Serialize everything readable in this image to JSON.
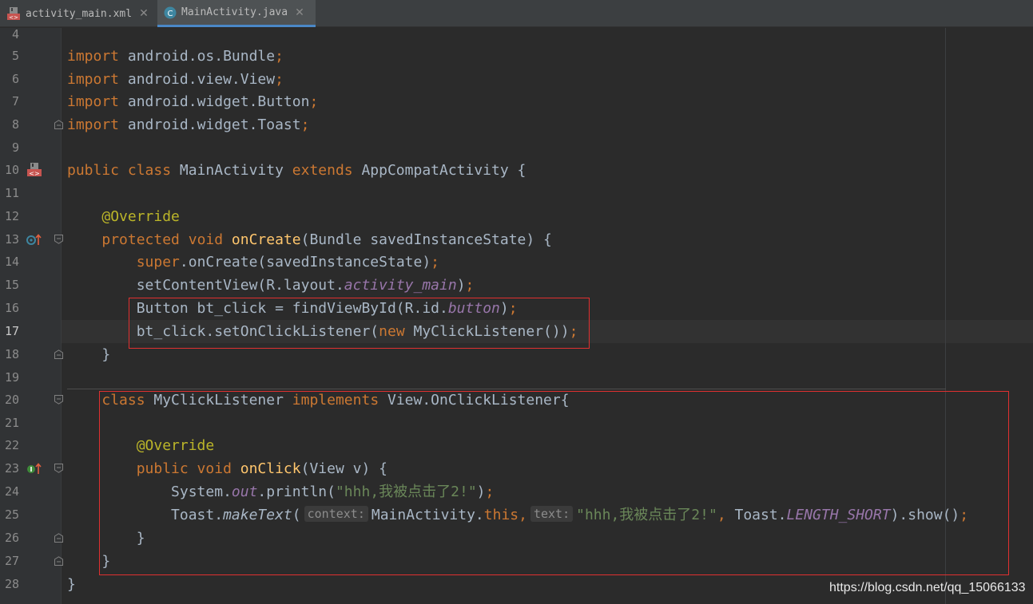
{
  "tabs": [
    {
      "label": "activity_main.xml",
      "icon": "xml-file-icon",
      "active": false
    },
    {
      "label": "MainActivity.java",
      "icon": "java-class-icon",
      "active": true
    }
  ],
  "code": {
    "l4": {
      "n": "4"
    },
    "l5": {
      "n": "5",
      "k": "import",
      "t": " android.os.Bundle",
      "sc": ";"
    },
    "l6": {
      "n": "6",
      "k": "import",
      "t": " android.view.View",
      "sc": ";"
    },
    "l7": {
      "n": "7",
      "k": "import",
      "t": " android.widget.Button",
      "sc": ";"
    },
    "l8": {
      "n": "8",
      "k": "import",
      "t": " android.widget.Toast",
      "sc": ";"
    },
    "l9": {
      "n": "9"
    },
    "l10": {
      "n": "10",
      "k1": "public class",
      "t1": " MainActivity ",
      "k2": "extends",
      "t2": " AppCompatActivity {"
    },
    "l11": {
      "n": "11"
    },
    "l12": {
      "n": "12",
      "ind": "    ",
      "ann": "@Override"
    },
    "l13": {
      "n": "13",
      "ind": "    ",
      "k": "protected void ",
      "fn": "onCreate",
      "t": "(Bundle savedInstanceState) {"
    },
    "l14": {
      "n": "14",
      "ind": "        ",
      "k": "super",
      "t": ".onCreate(savedInstanceState)",
      "sc": ";"
    },
    "l15": {
      "n": "15",
      "ind": "        ",
      "t": "setContentView(R.layout.",
      "f": "activity_main",
      "t2": ")",
      "sc": ";"
    },
    "l16": {
      "n": "16",
      "ind": "        ",
      "t": "Button bt_click = findViewById(R.id.",
      "f": "button",
      "t2": ")",
      "sc": ";"
    },
    "l17": {
      "n": "17",
      "ind": "        ",
      "t": "bt_click.setOnClickListener(",
      "k": "new",
      "t2": " MyClickListener())",
      "sc": ";"
    },
    "l18": {
      "n": "18",
      "ind": "    ",
      "t": "}"
    },
    "l19": {
      "n": "19"
    },
    "l20": {
      "n": "20",
      "ind": "    ",
      "k": "class",
      "t": " MyClickListener ",
      "k2": "implements",
      "t2": " View.OnClickListener{"
    },
    "l21": {
      "n": "21"
    },
    "l22": {
      "n": "22",
      "ind": "        ",
      "ann": "@Override"
    },
    "l23": {
      "n": "23",
      "ind": "        ",
      "k": "public void ",
      "fn": "onClick",
      "t": "(View v) {"
    },
    "l24": {
      "n": "24",
      "ind": "            ",
      "t": "System.",
      "f": "out",
      "t2": ".println(",
      "s": "\"hhh,我被点击了2!\"",
      "t3": ")",
      "sc": ";"
    },
    "l25": {
      "n": "25",
      "ind": "            ",
      "t": "Toast.",
      "m": "makeText",
      "t2": "(",
      "h1": "context:",
      "t3": "MainActivity.",
      "k": "this,",
      "h2": "text:",
      "s": "\"hhh,我被点击了2!\"",
      "c": ",",
      "t4": " Toast.",
      "f": "LENGTH_SHORT",
      "t5": ").show()",
      "sc": ";"
    },
    "l26": {
      "n": "26",
      "ind": "        ",
      "t": "}"
    },
    "l27": {
      "n": "27",
      "ind": "    ",
      "t": "}"
    },
    "l28": {
      "n": "28",
      "t": "}"
    }
  },
  "watermark": "https://blog.csdn.net/qq_15066133",
  "colors": {
    "keyword": "#cc7832",
    "annotation": "#bbb529",
    "method": "#ffc66d",
    "string": "#6a8759",
    "static_field": "#9876aa",
    "highlight_box": "#e03030"
  }
}
